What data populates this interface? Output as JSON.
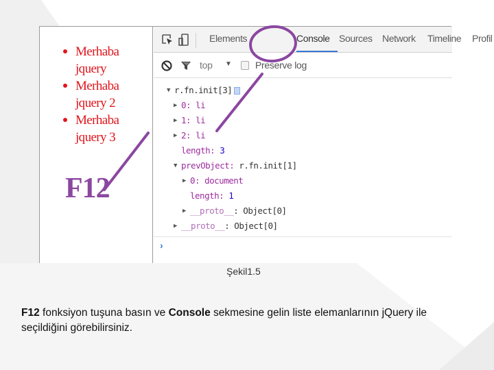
{
  "figure": {
    "page_list_items": [
      "Merhaba jquery",
      "Merhaba jquery 2",
      "Merhaba jquery 3"
    ],
    "f12_label": "F12",
    "devtools": {
      "tabs": [
        "Elements",
        "Console",
        "Sources",
        "Network",
        "Timeline",
        "Profil"
      ],
      "active_tab": "Console",
      "filter_context": "top",
      "preserve_log_label": "Preserve log",
      "preserve_log_checked": false,
      "console_tree": [
        {
          "arrow": "down",
          "key": "r.fn.init[3]",
          "sep": "",
          "val": "",
          "indent": 0
        },
        {
          "arrow": "right",
          "key": "0",
          "sep": ": ",
          "val": "li",
          "indent": 1
        },
        {
          "arrow": "right",
          "key": "1",
          "sep": ": ",
          "val": "li",
          "indent": 1
        },
        {
          "arrow": "right",
          "key": "2",
          "sep": ": ",
          "val": "li",
          "indent": 1
        },
        {
          "arrow": "",
          "key": "length",
          "sep": ": ",
          "val": "3",
          "indent": 1
        },
        {
          "arrow": "down",
          "key": "prevObject",
          "sep": ": ",
          "val": "r.fn.init[1]",
          "indent": 1
        },
        {
          "arrow": "right",
          "key": "0",
          "sep": ": ",
          "val": "document",
          "indent": 2
        },
        {
          "arrow": "",
          "key": "length",
          "sep": ": ",
          "val": "1",
          "indent": 2
        },
        {
          "arrow": "right",
          "key": "__proto__",
          "sep": ": ",
          "val": "Object[0]",
          "indent": 2
        },
        {
          "arrow": "right",
          "key": "__proto__",
          "sep": ": ",
          "val": "Object[0]",
          "indent": 1
        }
      ],
      "prompt_symbol": "›"
    },
    "caption": "Şekil1.5"
  },
  "description": {
    "bold_1": "F12",
    "text_1": " fonksiyon tuşuna basın ve ",
    "bold_2": "Console",
    "text_2": " sekmesine gelin liste elemanlarının jQuery ile seçildiğini görebilirsiniz."
  },
  "colors": {
    "list_text": "#e0151c",
    "annotation": "#8b47a0",
    "console_key": "#9c2c9f",
    "console_number": "#1c00cf",
    "active_tab_underline": "#3879d9"
  }
}
